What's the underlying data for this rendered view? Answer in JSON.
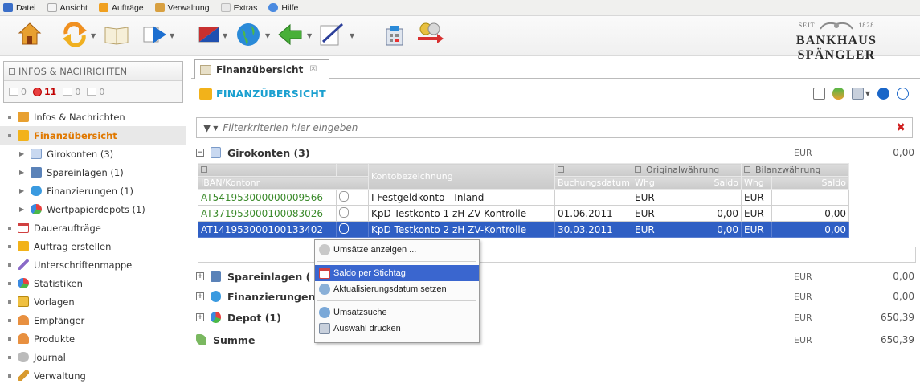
{
  "menubar": {
    "items": [
      {
        "label": "Datei",
        "icon": "app-icon"
      },
      {
        "label": "Ansicht",
        "icon": "page-icon"
      },
      {
        "label": "Aufträge",
        "icon": "orders-icon"
      },
      {
        "label": "Verwaltung",
        "icon": "wrench-icon"
      },
      {
        "label": "Extras",
        "icon": "extras-icon"
      },
      {
        "label": "Hilfe",
        "icon": "help-icon"
      }
    ]
  },
  "toolbar": {
    "icons": [
      "home-icon",
      "refresh-icon",
      "book-icon",
      "forward-icon",
      "flag-icon",
      "globe-icon",
      "back-arrow-icon",
      "sign-icon",
      "calculator-icon",
      "currency-exchange-icon"
    ]
  },
  "logo": {
    "seit": "SEIT",
    "year": "1828",
    "name": "BANKHAUS SPÄNGLER"
  },
  "infobox": {
    "title": "INFOS & NACHRICHTEN",
    "counts": [
      "0",
      "11",
      "0",
      "0"
    ]
  },
  "nav": {
    "items": [
      {
        "label": "Infos & Nachrichten"
      },
      {
        "label": "Finanzübersicht"
      },
      {
        "label": "Girokonten (3)"
      },
      {
        "label": "Spareinlagen (1)"
      },
      {
        "label": "Finanzierungen (1)"
      },
      {
        "label": "Wertpapierdepots (1)"
      },
      {
        "label": "Daueraufträge"
      },
      {
        "label": "Auftrag erstellen"
      },
      {
        "label": "Unterschriftenmappe"
      },
      {
        "label": "Statistiken"
      },
      {
        "label": "Vorlagen"
      },
      {
        "label": "Empfänger"
      },
      {
        "label": "Produkte"
      },
      {
        "label": "Journal"
      },
      {
        "label": "Verwaltung"
      }
    ]
  },
  "tab": {
    "label": "Finanzübersicht",
    "close": "☒"
  },
  "content": {
    "title": "FINANZÜBERSICHT"
  },
  "filter": {
    "placeholder": "Filterkriterien hier eingeben"
  },
  "sections": {
    "girokonten": {
      "label": "Girokonten (3)",
      "currency": "EUR",
      "amount": "0,00",
      "toggle": "−"
    },
    "spareinlagen": {
      "label": "Spareinlagen (",
      "currency": "EUR",
      "amount": "0,00",
      "toggle": "+"
    },
    "finanzierungen": {
      "label": "Finanzierungen",
      "currency": "EUR",
      "amount": "0,00",
      "toggle": "+"
    },
    "depot": {
      "label": "Depot (1)",
      "currency": "EUR",
      "amount": "650,39",
      "toggle": "+"
    },
    "summe": {
      "label": "Summe",
      "currency": "EUR",
      "amount": "650,39"
    }
  },
  "table": {
    "headers": {
      "iban": "IBAN/Kontonr",
      "bezeichnung": "Kontobezeichnung",
      "buchungsdatum": "Buchungsdatum",
      "original": "Originalwährung",
      "bilanz": "Bilanzwährung",
      "whg": "Whg",
      "saldo": "Saldo"
    },
    "rows": [
      {
        "iban": "AT541953000000009566",
        "bezeichnung": "I Festgeldkonto - Inland",
        "datum": "",
        "whg1": "EUR",
        "saldo1": "",
        "whg2": "EUR",
        "saldo2": ""
      },
      {
        "iban": "AT371953000100083026",
        "bezeichnung": "KpD Testkonto 1 zH ZV-Kontrolle",
        "datum": "01.06.2011",
        "whg1": "EUR",
        "saldo1": "0,00",
        "whg2": "EUR",
        "saldo2": "0,00"
      },
      {
        "iban": "AT141953000100133402",
        "bezeichnung": "KpD Testkonto 2 zH ZV-Kontrolle",
        "datum": "30.03.2011",
        "whg1": "EUR",
        "saldo1": "0,00",
        "whg2": "EUR",
        "saldo2": "0,00"
      }
    ]
  },
  "contextmenu": {
    "items": [
      "Umsätze anzeigen ...",
      "Saldo per Stichtag",
      "Aktualisierungsdatum setzen",
      "Umsatzsuche",
      "Auswahl drucken"
    ]
  },
  "colors": {
    "accent": "#1aa0d0",
    "selected_nav": "#e07800",
    "selection": "#2f5fc4",
    "iban": "#3a8a2a"
  }
}
